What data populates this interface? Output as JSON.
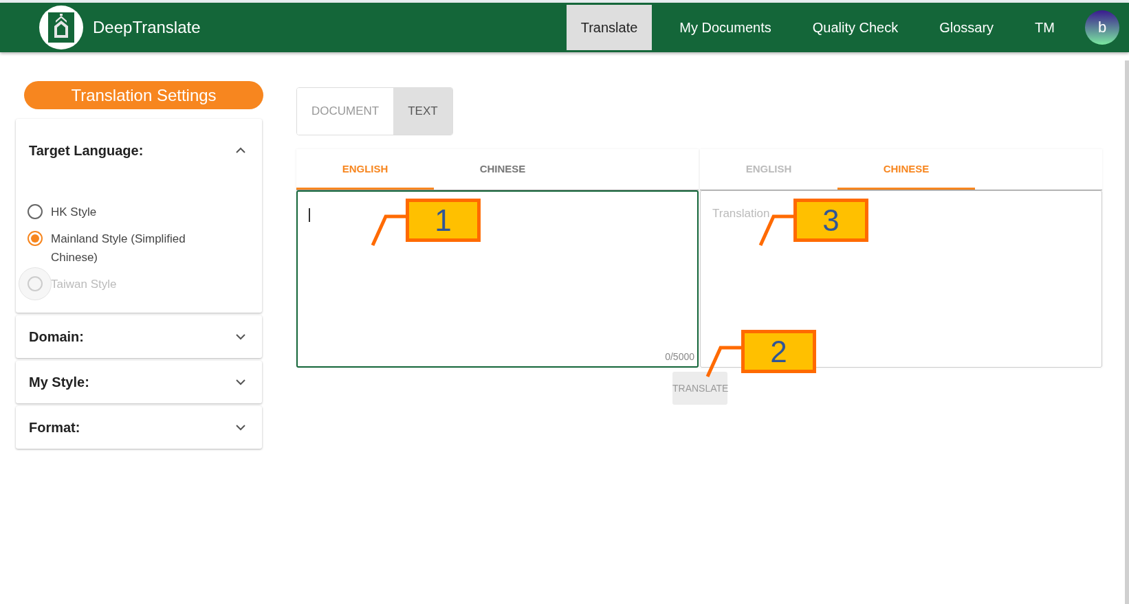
{
  "header": {
    "brand": "DeepTranslate",
    "nav": [
      {
        "label": "Translate",
        "selected": true
      },
      {
        "label": "My Documents",
        "selected": false
      },
      {
        "label": "Quality Check",
        "selected": false
      },
      {
        "label": "Glossary",
        "selected": false
      },
      {
        "label": "TM",
        "selected": false
      }
    ],
    "avatar": "b"
  },
  "sidebar": {
    "title": "Translation Settings",
    "sections": [
      {
        "title": "Target Language:",
        "expanded": true,
        "options": [
          {
            "label": "HK Style",
            "selected": false,
            "disabled": false
          },
          {
            "label": "Mainland Style (Simplified Chinese)",
            "selected": true,
            "disabled": false
          },
          {
            "label": "Taiwan Style",
            "selected": false,
            "disabled": true
          }
        ]
      },
      {
        "title": "Domain:",
        "expanded": false
      },
      {
        "title": "My Style:",
        "expanded": false
      },
      {
        "title": "Format:",
        "expanded": false
      }
    ]
  },
  "mode_tabs": [
    {
      "label": "DOCUMENT",
      "selected": false
    },
    {
      "label": "TEXT",
      "selected": true
    }
  ],
  "source": {
    "tabs": [
      {
        "label": "ENGLISH",
        "selected": true
      },
      {
        "label": "CHINESE",
        "selected": false
      }
    ],
    "counter": "0/5000",
    "focused": true
  },
  "target": {
    "tabs": [
      {
        "label": "ENGLISH",
        "selected": false
      },
      {
        "label": "CHINESE",
        "selected": true
      }
    ],
    "placeholder": "Translation"
  },
  "translate_button": {
    "label": "TRANSLATE",
    "disabled": true
  },
  "callouts": [
    {
      "label": "1"
    },
    {
      "label": "2"
    },
    {
      "label": "3"
    }
  ]
}
